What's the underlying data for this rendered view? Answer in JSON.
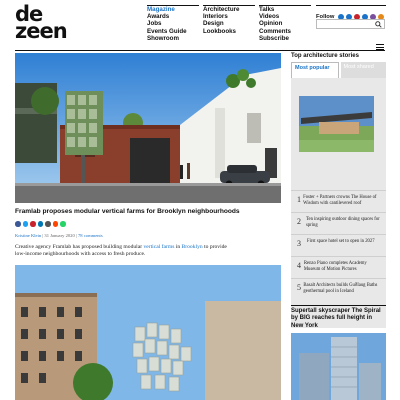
{
  "brand": {
    "line1": "de",
    "line2": "zeen"
  },
  "nav": {
    "col1": [
      "Magazine",
      "Awards",
      "Jobs",
      "Events Guide",
      "Showroom"
    ],
    "col2": [
      "Architecture",
      "Interiors",
      "Design",
      "Lookbooks"
    ],
    "col3": [
      "Talks",
      "Videos",
      "Opinion",
      "Comments",
      "Subscribe"
    ]
  },
  "follow": {
    "label": "Follow"
  },
  "article": {
    "title": "Framlab proposes modular vertical farms for Brooklyn neighbourhoods",
    "author": "Kristine Klein",
    "date": "31 January 2020",
    "comments": "78 comments",
    "standfirst_a": "Creative agency Framlab has proposed building modular ",
    "link1": "vertical farms",
    "standfirst_b": " in ",
    "link2": "Brooklyn",
    "standfirst_c": " to provide low-income neighbourhoods with access to fresh produce."
  },
  "sidebar": {
    "heading": "Top architecture stories",
    "tabs": [
      "Most popular",
      "Most shared"
    ],
    "items": [
      {
        "num": "1",
        "title": "Foster + Partners crowns The House of Wisdom with cantilevered roof"
      },
      {
        "num": "2",
        "title": "Ten inspiring outdoor dining spaces for spring"
      },
      {
        "num": "3",
        "title": "First space hotel set to open in 2027"
      },
      {
        "num": "4",
        "title": "Renzo Piano completes Academy Museum of Motion Pictures"
      },
      {
        "num": "5",
        "title": "Basalt Architects builds GuðIaug Baths geothermal pool in Iceland"
      }
    ],
    "promo_title": "Supertall skyscraper The Spiral by BIG reaches full height in New York"
  },
  "colors": {
    "accent": "#1a73c8"
  },
  "icons": [
    "facebook-icon",
    "twitter-icon",
    "pinterest-icon",
    "linkedin-icon",
    "instagram-icon",
    "rss-icon",
    "search-icon",
    "menu-icon"
  ]
}
